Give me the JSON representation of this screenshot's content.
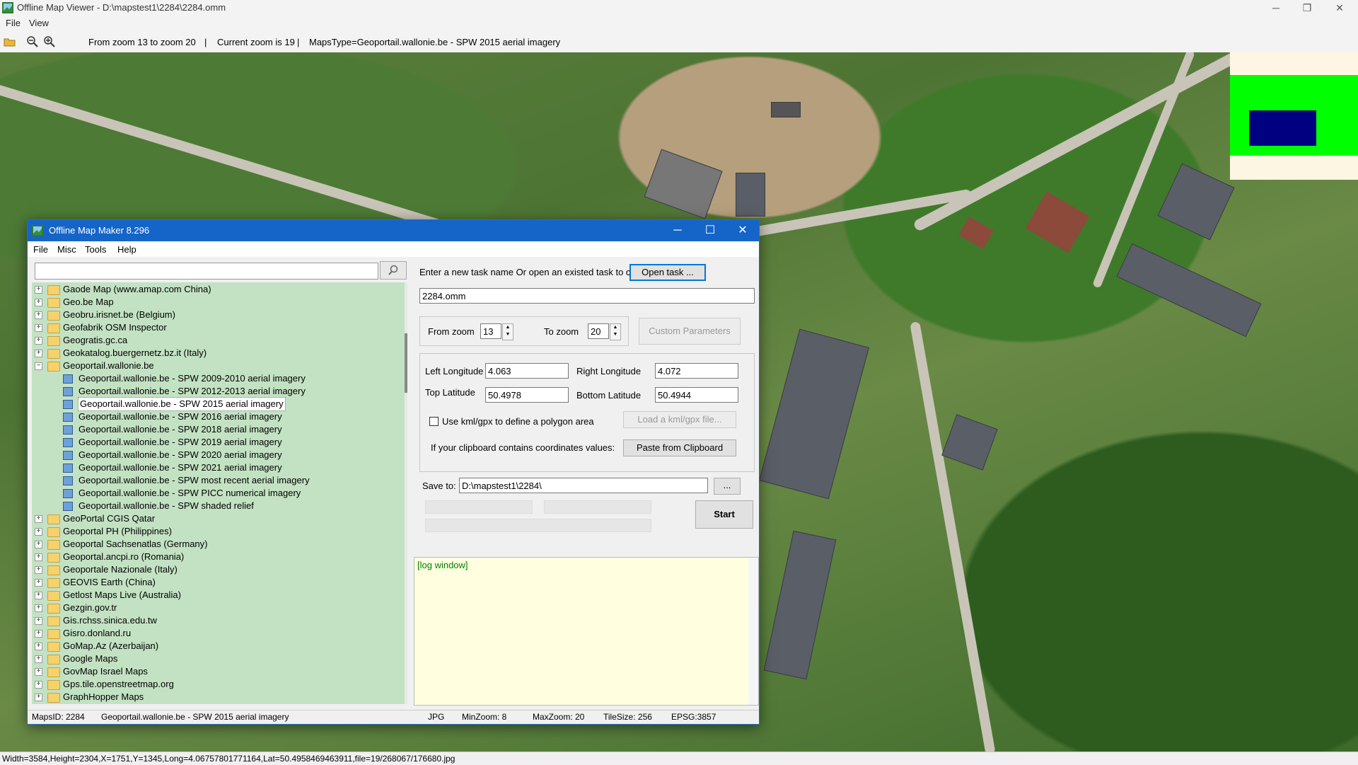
{
  "window": {
    "title": "Offline Map Viewer - D:\\mapstest1\\2284\\2284.omm",
    "controls": {
      "minimize": "─",
      "maximize": "❐",
      "close": "✕"
    }
  },
  "menu": [
    "File",
    "View"
  ],
  "toolbar": {
    "zoom_range": "From zoom 13 to zoom 20",
    "separator1": "|",
    "current_zoom": "Current zoom is 19",
    "separator2": "|",
    "maps_type": "MapsType=Geoportail.wallonie.be - SPW 2015 aerial imagery"
  },
  "status_bar": "Width=3584,Height=2304,X=1751,Y=1345,Long=4.06757801771164,Lat=50.4958469463911,file=19/268067/176680.jpg",
  "dialog": {
    "title": "Offline Map Maker 8.296",
    "controls": {
      "minimize": "─",
      "maximize": "☐",
      "close": "✕"
    },
    "menu": [
      "File",
      "Misc",
      "Tools",
      "Help"
    ],
    "search": {
      "value": "",
      "button_icon": "search-icon"
    },
    "tree": [
      {
        "label": "Gaode Map (www.amap.com China)",
        "type": "folder",
        "expanded": false
      },
      {
        "label": "Geo.be Map",
        "type": "folder",
        "expanded": false
      },
      {
        "label": "Geobru.irisnet.be (Belgium)",
        "type": "folder",
        "expanded": false
      },
      {
        "label": "Geofabrik OSM Inspector",
        "type": "folder",
        "expanded": false
      },
      {
        "label": "Geogratis.gc.ca",
        "type": "folder",
        "expanded": false
      },
      {
        "label": "Geokatalog.buergernetz.bz.it (Italy)",
        "type": "folder",
        "expanded": false
      },
      {
        "label": "Geoportail.wallonie.be",
        "type": "folder",
        "expanded": true
      },
      {
        "label": "Geoportail.wallonie.be - SPW 2009-2010 aerial imagery",
        "type": "map"
      },
      {
        "label": "Geoportail.wallonie.be - SPW 2012-2013 aerial imagery",
        "type": "map"
      },
      {
        "label": "Geoportail.wallonie.be - SPW 2015 aerial imagery",
        "type": "map",
        "selected": true
      },
      {
        "label": "Geoportail.wallonie.be - SPW 2016 aerial imagery",
        "type": "map"
      },
      {
        "label": "Geoportail.wallonie.be - SPW 2018 aerial imagery",
        "type": "map"
      },
      {
        "label": "Geoportail.wallonie.be - SPW 2019 aerial imagery",
        "type": "map"
      },
      {
        "label": "Geoportail.wallonie.be - SPW 2020 aerial imagery",
        "type": "map"
      },
      {
        "label": "Geoportail.wallonie.be - SPW 2021 aerial imagery",
        "type": "map"
      },
      {
        "label": "Geoportail.wallonie.be - SPW most recent aerial imagery",
        "type": "map"
      },
      {
        "label": "Geoportail.wallonie.be - SPW PICC numerical imagery",
        "type": "map"
      },
      {
        "label": "Geoportail.wallonie.be - SPW shaded relief",
        "type": "map"
      },
      {
        "label": "GeoPortal CGIS Qatar",
        "type": "folder",
        "expanded": false
      },
      {
        "label": "Geoportal PH (Philippines)",
        "type": "folder",
        "expanded": false
      },
      {
        "label": "Geoportal Sachsenatlas (Germany)",
        "type": "folder",
        "expanded": false
      },
      {
        "label": "Geoportal.ancpi.ro (Romania)",
        "type": "folder",
        "expanded": false
      },
      {
        "label": "Geoportale Nazionale (Italy)",
        "type": "folder",
        "expanded": false
      },
      {
        "label": "GEOVIS Earth (China)",
        "type": "folder",
        "expanded": false
      },
      {
        "label": "Getlost Maps Live (Australia)",
        "type": "folder",
        "expanded": false
      },
      {
        "label": "Gezgin.gov.tr",
        "type": "folder",
        "expanded": false
      },
      {
        "label": "Gis.rchss.sinica.edu.tw",
        "type": "folder",
        "expanded": false
      },
      {
        "label": "Gisro.donland.ru",
        "type": "folder",
        "expanded": false
      },
      {
        "label": "GoMap.Az (Azerbaijan)",
        "type": "folder",
        "expanded": false
      },
      {
        "label": "Google Maps",
        "type": "folder",
        "expanded": false
      },
      {
        "label": "GovMap Israel Maps",
        "type": "folder",
        "expanded": false
      },
      {
        "label": "Gps.tile.openstreetmap.org",
        "type": "folder",
        "expanded": false
      },
      {
        "label": "GraphHopper Maps",
        "type": "folder",
        "expanded": false
      }
    ],
    "task": {
      "prompt": "Enter a new task name Or open an existed task to continue:",
      "open_button": "Open task ...",
      "name_value": "2284.omm"
    },
    "zoom": {
      "from_label": "From zoom",
      "from_value": "13",
      "to_label": "To zoom",
      "to_value": "20",
      "custom_button": "Custom Parameters"
    },
    "bounds": {
      "left_lon_label": "Left Longitude",
      "left_lon_value": "4.063",
      "right_lon_label": "Right Longitude",
      "right_lon_value": "4.072",
      "top_lat_label": "Top Latitude",
      "top_lat_value": "50.4978",
      "bottom_lat_label": "Bottom Latitude",
      "bottom_lat_value": "50.4944",
      "kml_checkbox_label": "Use kml/gpx to define a polygon area",
      "kml_checked": false,
      "load_kml_button": "Load a kml/gpx file...",
      "clipboard_label": "If your clipboard contains coordinates values:",
      "paste_button": "Paste from Clipboard"
    },
    "save": {
      "label": "Save to:",
      "path": "D:\\mapstest1\\2284\\",
      "browse_button": "..."
    },
    "progress": [
      0,
      0,
      0
    ],
    "start_button": "Start",
    "log": "[log window]",
    "status": {
      "maps_id": "MapsID: 2284",
      "maps_name": "Geoportail.wallonie.be - SPW 2015 aerial imagery",
      "format": "JPG",
      "min_zoom": "MinZoom: 8",
      "max_zoom": "MaxZoom: 20",
      "tile_size": "TileSize: 256",
      "epsg": "EPSG:3857"
    }
  },
  "colors": {
    "dialog_titlebar": "#1565c8",
    "tree_background": "#c3e2c3",
    "log_background": "#ffffe0",
    "log_text": "#008000",
    "minimap_frame": "#00ff00",
    "minimap_view": "#000080"
  }
}
